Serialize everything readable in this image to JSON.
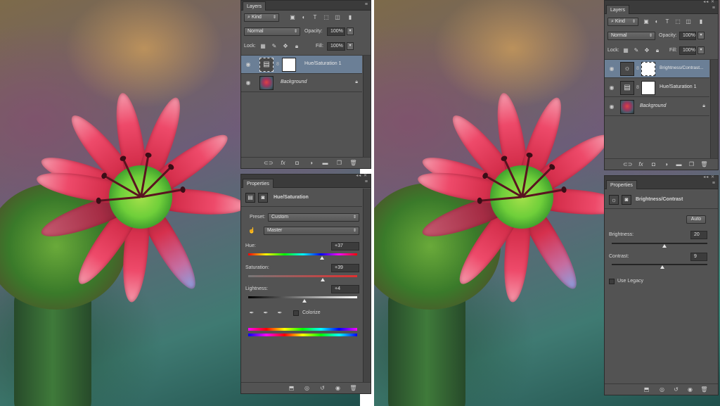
{
  "left": {
    "layers_panel": {
      "tab": "Layers",
      "filter_kind": "Kind",
      "blend_mode": "Normal",
      "opacity_label": "Opacity:",
      "opacity_value": "100%",
      "lock_label": "Lock:",
      "fill_label": "Fill:",
      "fill_value": "100%",
      "layers": [
        {
          "name": "Hue/Saturation 1",
          "type": "adjustment",
          "selected": true
        },
        {
          "name": "Background",
          "type": "image",
          "selected": false,
          "locked": true
        }
      ]
    },
    "properties_panel": {
      "tab": "Properties",
      "title": "Hue/Saturation",
      "preset_label": "Preset:",
      "preset_value": "Custom",
      "channel_value": "Master",
      "hue_label": "Hue:",
      "hue_value": "+37",
      "saturation_label": "Saturation:",
      "saturation_value": "+39",
      "lightness_label": "Lightness:",
      "lightness_value": "+4",
      "colorize_label": "Colorize"
    }
  },
  "right": {
    "layers_panel": {
      "tab": "Layers",
      "filter_kind": "Kind",
      "blend_mode": "Normal",
      "opacity_label": "Opacity:",
      "opacity_value": "100%",
      "lock_label": "Lock:",
      "fill_label": "Fill:",
      "fill_value": "100%",
      "layers": [
        {
          "name": "Brightness/Contrast...",
          "type": "adjustment",
          "selected": true
        },
        {
          "name": "Hue/Saturation 1",
          "type": "adjustment",
          "selected": false
        },
        {
          "name": "Background",
          "type": "image",
          "selected": false,
          "locked": true
        }
      ]
    },
    "properties_panel": {
      "tab": "Properties",
      "title": "Brightness/Contrast",
      "auto_label": "Auto",
      "brightness_label": "Brightness:",
      "brightness_value": "20",
      "contrast_label": "Contrast:",
      "contrast_value": "9",
      "legacy_label": "Use Legacy"
    }
  },
  "colors": {
    "panel_bg": "#535353",
    "panel_dark": "#3b3b3b",
    "selection": "#6b7f96"
  }
}
